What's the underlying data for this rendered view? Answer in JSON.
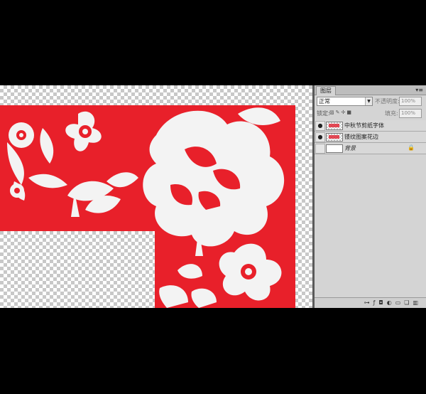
{
  "layers_panel": {
    "tab_title": "图层",
    "menu_icon": "panel-menu-icon",
    "blend_mode": "正常",
    "opacity_label": "不透明度:",
    "opacity_value": "100%",
    "lock_label": "锁定:",
    "fill_label": "填充:",
    "fill_value": "100%",
    "layers": [
      {
        "name": "中秋节剪纸字体",
        "visible": true,
        "thumbnail": "text"
      },
      {
        "name": "镂纹图案花边",
        "visible": true,
        "thumbnail": "pattern"
      },
      {
        "name": "背景",
        "visible": false,
        "thumbnail": "white",
        "locked": true
      }
    ]
  },
  "canvas": {
    "pattern_color": "#e8202a",
    "transparency_grid": true
  },
  "footer_icons": [
    "link-icon",
    "fx-icon",
    "mask-icon",
    "adjustment-icon",
    "group-icon",
    "new-layer-icon",
    "delete-icon"
  ]
}
